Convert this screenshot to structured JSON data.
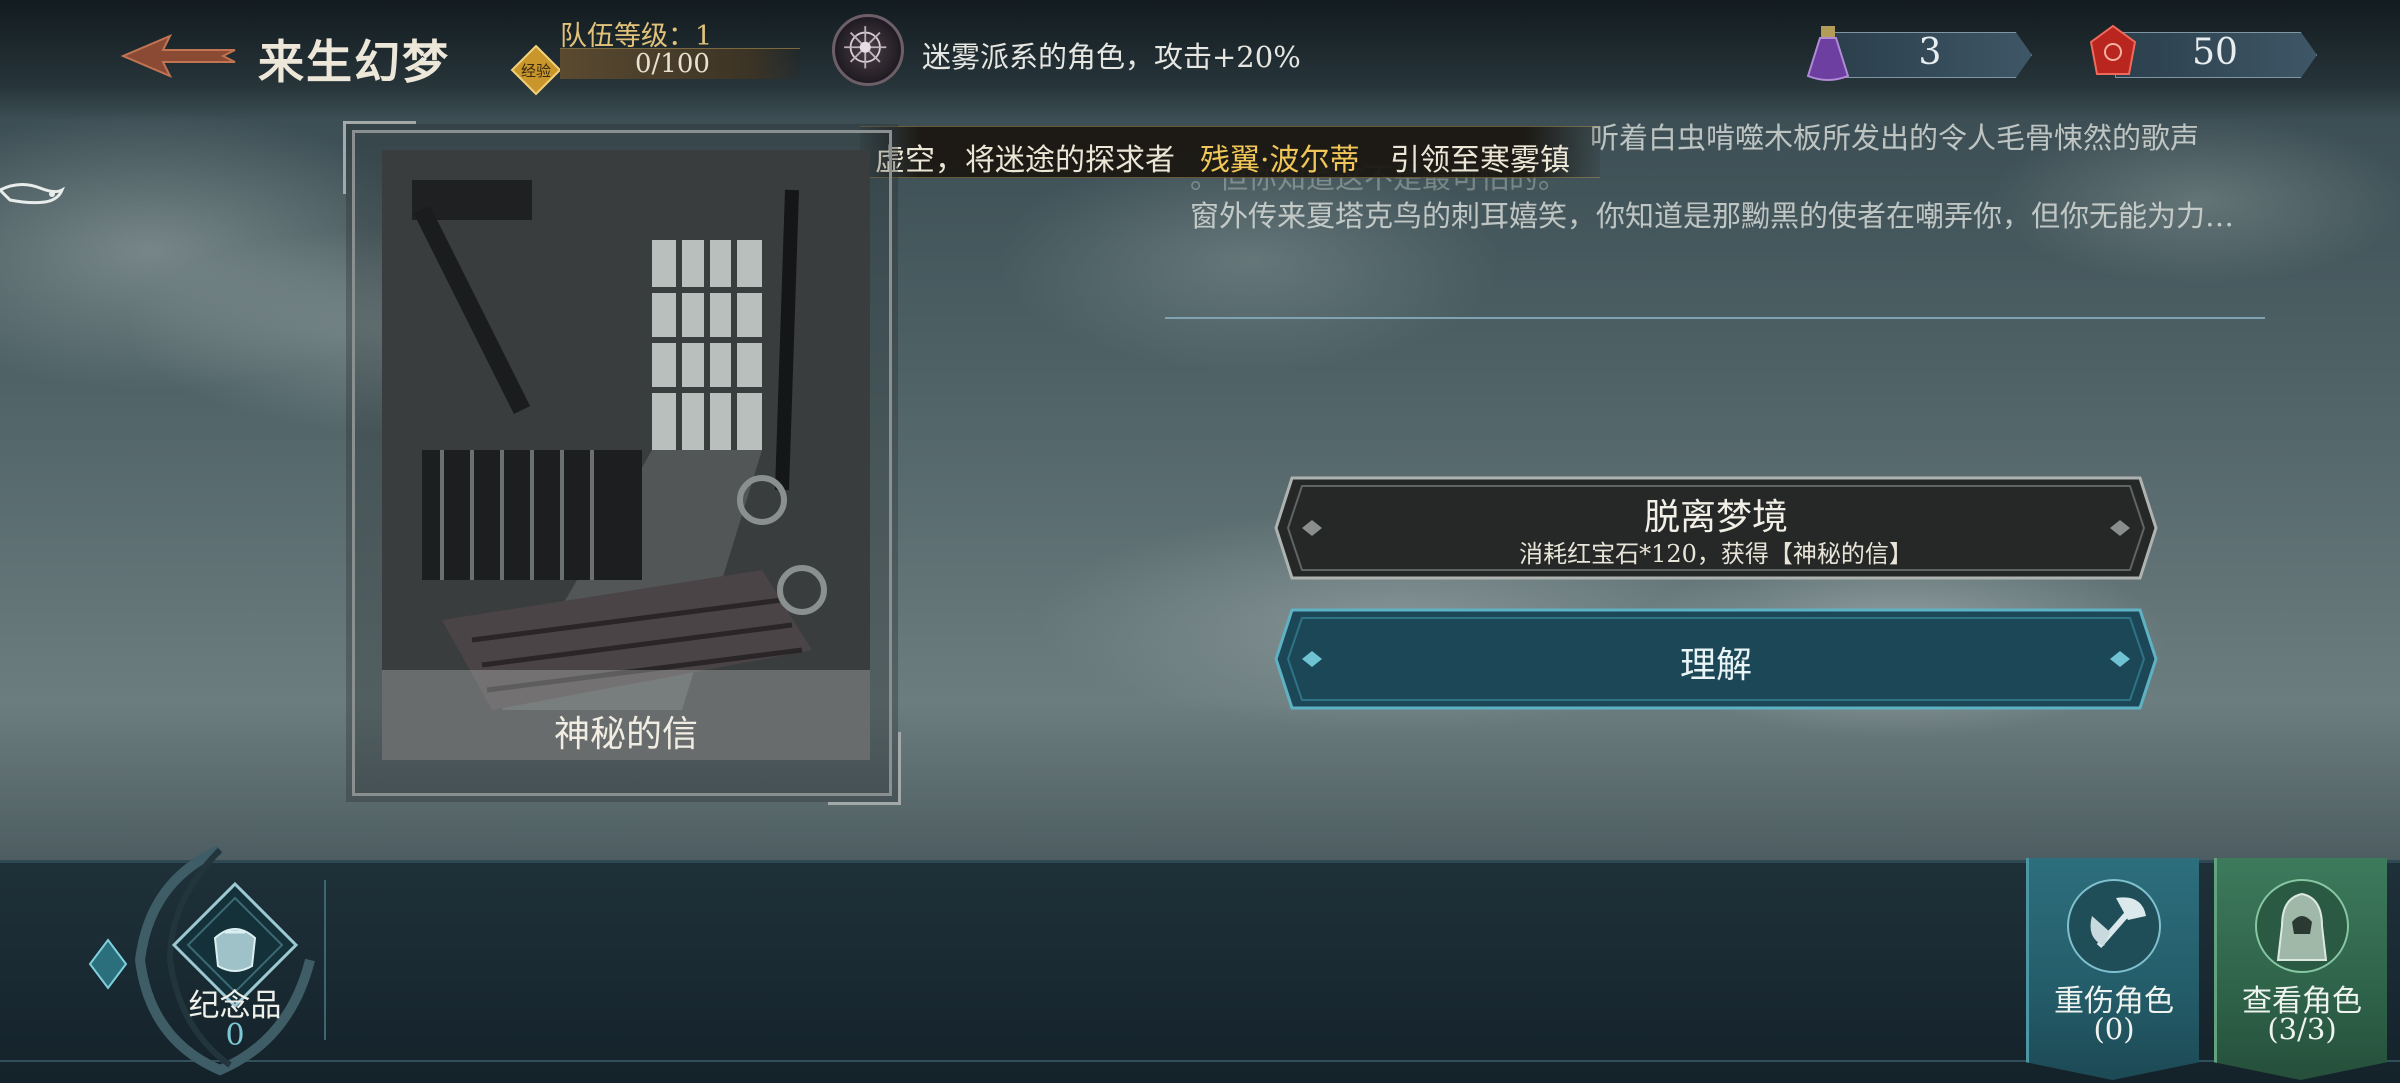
{
  "header": {
    "title": "来生幻梦",
    "team_level": "队伍等级：1",
    "exp_badge": "经验",
    "exp_progress": "0/100",
    "exp_fraction": 0,
    "buff": "迷雾派系的角色，攻击+20%"
  },
  "currencies": [
    {
      "icon": "potion-icon",
      "value": "3",
      "color": "#7b4ea8"
    },
    {
      "icon": "ruby-icon",
      "value": "50",
      "color": "#c0302a"
    }
  ],
  "story": {
    "banner_pre": "虚空，将迷途的探求者",
    "banner_name": "残翼·波尔蒂",
    "banner_post": "引领至寒雾镇",
    "line1": "听着白虫啃噬木板所发出的令人毛骨悚然的歌声",
    "line2": "。但你知道这不是最可怕的。",
    "line3": "窗外传来夏塔克鸟的刺耳嬉笑，你知道是那黝黑的使者在嘲弄你，但你无能为力…"
  },
  "card": {
    "name": "神秘的信"
  },
  "choices": [
    {
      "title": "脱离梦境",
      "subtitle": "消耗红宝石*120，获得【神秘的信】"
    },
    {
      "title": "理解",
      "subtitle": ""
    }
  ],
  "bottom": {
    "memento_label": "纪念品",
    "memento_count": "0",
    "injured_label": "重伤角色",
    "injured_count": "(0)",
    "view_label": "查看角色",
    "view_count": "(3/3)"
  },
  "colors": {
    "gold_accent": "#f0c658",
    "teal_button": "#1d4d5c",
    "dark_button": "#2a2a2a"
  }
}
